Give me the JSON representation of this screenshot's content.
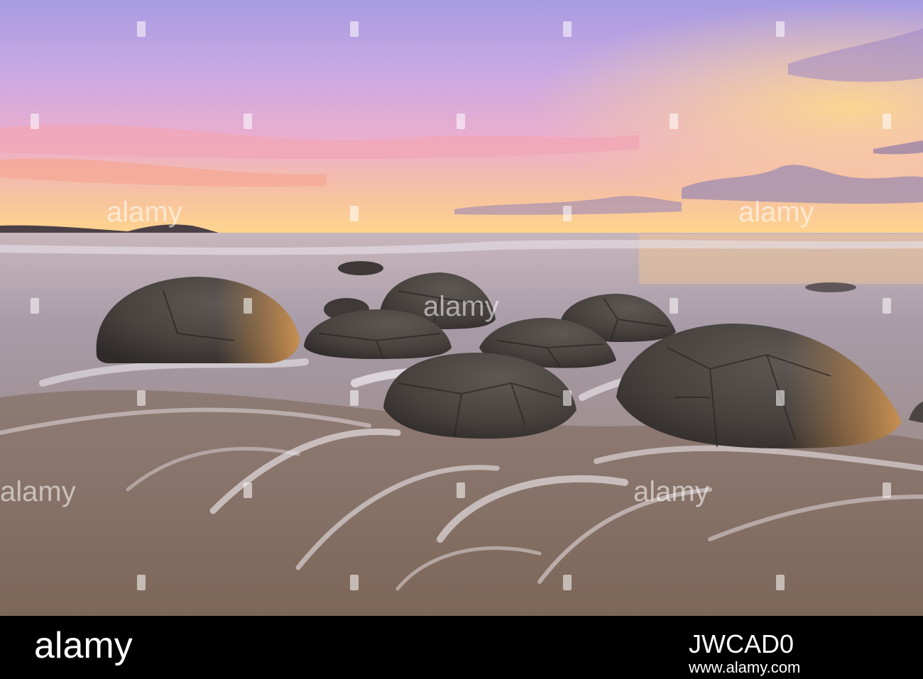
{
  "scene": {
    "subject": "boulders-on-beach-at-sunrise",
    "palette": {
      "sky_top": "#b7a2e8",
      "sky_mid": "#e6a8cf",
      "horizon": "#ffcf8a",
      "sea": "#8d8a9e",
      "sand": "#8a7565",
      "foam": "#f2eef4",
      "boulder": "#4c4846",
      "boulder_highlight": "#c98b4a"
    }
  },
  "watermark": {
    "text": "alamy"
  },
  "footer": {
    "logo": "alamy",
    "image_id": "JWCAD0",
    "url": "www.alamy.com"
  }
}
